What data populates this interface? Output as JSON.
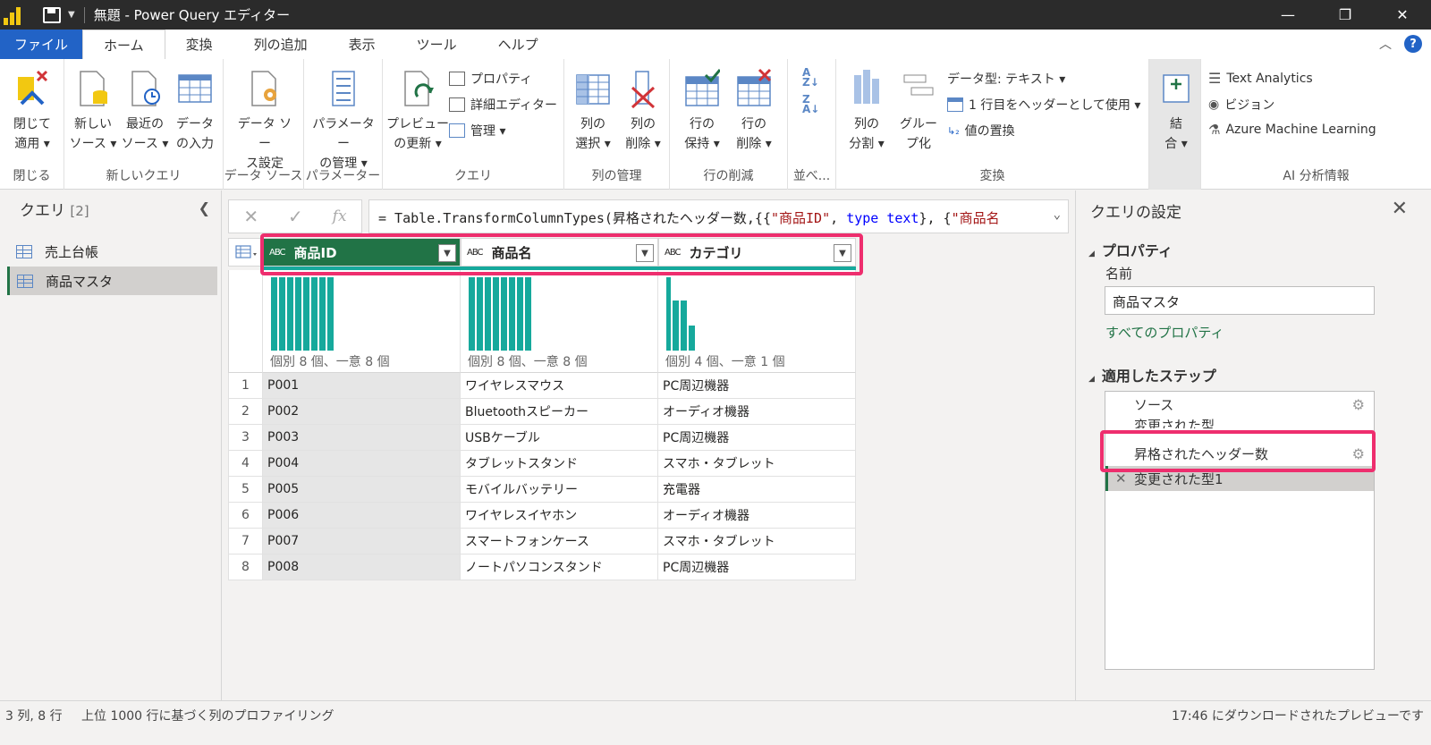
{
  "window": {
    "title": "無題 - Power Query エディター",
    "minimize": "—",
    "restore": "❐",
    "close": "✕"
  },
  "tabs": [
    {
      "label": "ファイル"
    },
    {
      "label": "ホーム"
    },
    {
      "label": "変換"
    },
    {
      "label": "列の追加"
    },
    {
      "label": "表示"
    },
    {
      "label": "ツール"
    },
    {
      "label": "ヘルプ"
    }
  ],
  "ribbon": {
    "close_apply": "閉じて\n適用 ▾",
    "new_source": "新しい\nソース ▾",
    "recent_source": "最近の\nソース ▾",
    "enter_data": "データ\nの入力",
    "ds_settings": "データ ソー\nス設定",
    "manage_params": "パラメーター\nの管理 ▾",
    "refresh_preview": "プレビュー\nの更新 ▾",
    "properties": "プロパティ",
    "advanced_editor": "詳細エディター",
    "manage": "管理 ▾",
    "choose_columns": "列の\n選択 ▾",
    "remove_columns": "列の\n削除 ▾",
    "keep_rows": "行の\n保持 ▾",
    "remove_rows": "行の\n削除 ▾",
    "split_column": "列の\n分割 ▾",
    "group_by": "グルー\nプ化",
    "data_type": "データ型: テキスト ▾",
    "use_first_row": "1 行目をヘッダーとして使用 ▾",
    "replace_values": "値の置換",
    "combine": "結\n合 ▾",
    "text_analytics": "Text Analytics",
    "vision": "ビジョン",
    "azure_ml": "Azure Machine Learning",
    "groups": {
      "close": "閉じる",
      "new_query": "新しいクエリ",
      "data_source": "データ ソース",
      "parameters": "パラメーター",
      "query": "クエリ",
      "manage_columns": "列の管理",
      "reduce_rows": "行の削減",
      "sort": "並べ...",
      "transform": "変換",
      "ai": "AI 分析情報"
    }
  },
  "queries_pane": {
    "title": "クエリ",
    "count": "[2]",
    "items": [
      {
        "label": "売上台帳"
      },
      {
        "label": "商品マスタ"
      }
    ]
  },
  "formula": {
    "prefix": "= Table.TransformColumnTypes(昇格されたヘッダー数,{{",
    "s1": "\"商品ID\"",
    "mid": ", ",
    "kw": "type text",
    "tail": "}, {",
    "s2": "\"商品名"
  },
  "table": {
    "columns": [
      {
        "type": "ABC",
        "name": "商品ID",
        "profile": "個別 8 個、一意 8 個"
      },
      {
        "type": "ABC",
        "name": "商品名",
        "profile": "個別 8 個、一意 8 個"
      },
      {
        "type": "ABC",
        "name": "カテゴリ",
        "profile": "個別 4 個、一意 1 個"
      }
    ],
    "rows": [
      {
        "n": "1",
        "c": [
          "P001",
          "ワイヤレスマウス",
          "PC周辺機器"
        ]
      },
      {
        "n": "2",
        "c": [
          "P002",
          "Bluetoothスピーカー",
          "オーディオ機器"
        ]
      },
      {
        "n": "3",
        "c": [
          "P003",
          "USBケーブル",
          "PC周辺機器"
        ]
      },
      {
        "n": "4",
        "c": [
          "P004",
          "タブレットスタンド",
          "スマホ・タブレット"
        ]
      },
      {
        "n": "5",
        "c": [
          "P005",
          "モバイルバッテリー",
          "充電器"
        ]
      },
      {
        "n": "6",
        "c": [
          "P006",
          "ワイヤレスイヤホン",
          "オーディオ機器"
        ]
      },
      {
        "n": "7",
        "c": [
          "P007",
          "スマートフォンケース",
          "スマホ・タブレット"
        ]
      },
      {
        "n": "8",
        "c": [
          "P008",
          "ノートパソコンスタンド",
          "PC周辺機器"
        ]
      }
    ]
  },
  "settings_pane": {
    "title": "クエリの設定",
    "properties": "プロパティ",
    "name_label": "名前",
    "name_value": "商品マスタ",
    "all_properties": "すべてのプロパティ",
    "applied_steps": "適用したステップ",
    "steps": [
      {
        "label": "ソース"
      },
      {
        "label": "変更された型"
      },
      {
        "label": "昇格されたヘッダー数"
      },
      {
        "label": "変更された型1"
      }
    ]
  },
  "status": {
    "left": "3 列, 8 行",
    "mid": "上位 1000 行に基づく列のプロファイリング",
    "right": "17:46 にダウンロードされたプレビューです"
  },
  "colors": {
    "accent_green": "#217346",
    "teal": "#16a99c",
    "highlight": "#ee2e6e",
    "file_tab": "#2263c6"
  }
}
